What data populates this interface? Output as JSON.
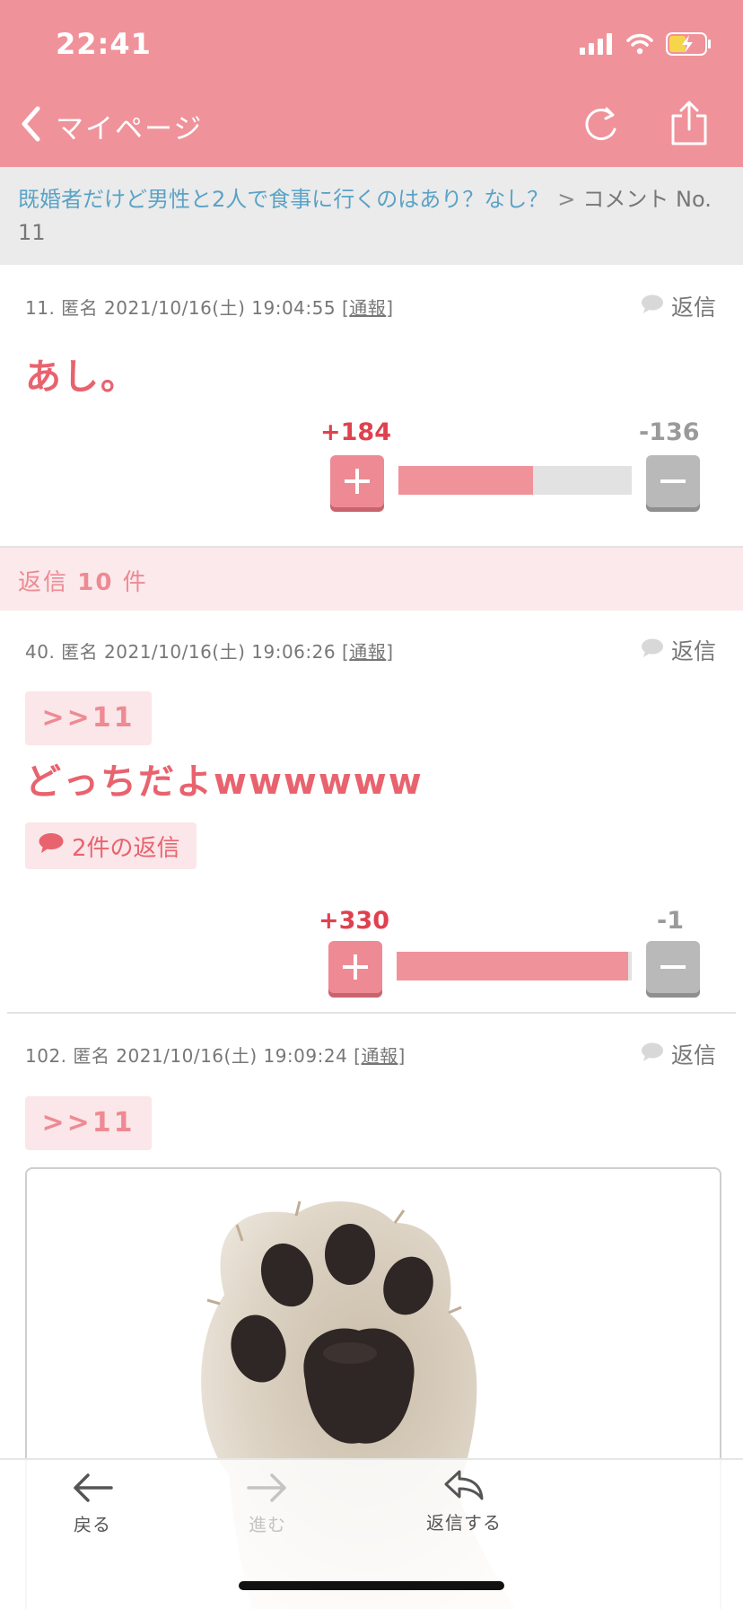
{
  "status_bar": {
    "time": "22:41"
  },
  "nav": {
    "back_label": "マイページ"
  },
  "breadcrumb": {
    "topic": "既婚者だけど男性と2人で食事に行くのはあり？なし？",
    "separator": ">",
    "current": "コメント No. 11"
  },
  "main_comment": {
    "number": "11.",
    "author": "匿名",
    "datetime": "2021/10/16(土) 19:04:55",
    "report_label": "通報",
    "reply_label": "返信",
    "body": "あし。",
    "plus_count": "+184",
    "minus_count": "-136",
    "plus_ratio": 0.575
  },
  "reply_section": {
    "prefix": "返信",
    "count": "10",
    "suffix": "件"
  },
  "replies": [
    {
      "number": "40.",
      "author": "匿名",
      "datetime": "2021/10/16(土) 19:06:26",
      "report_label": "通報",
      "reply_label": "返信",
      "anchor": ">>11",
      "body": "どっちだよwwwwww",
      "replies_chip": "2件の返信",
      "plus_count": "+330",
      "minus_count": "-1",
      "plus_ratio": 0.985
    },
    {
      "number": "102.",
      "author": "匿名",
      "datetime": "2021/10/16(土) 19:09:24",
      "report_label": "通報",
      "reply_label": "返信",
      "anchor": ">>11",
      "image": "cat-paw-photo"
    }
  ],
  "toolbar": {
    "back": "戻る",
    "forward": "進む",
    "reply": "返信する"
  },
  "colors": {
    "header": "#f0929a",
    "accent": "#e8636e",
    "plus": "#e0414f",
    "link": "#5aa3c7"
  }
}
